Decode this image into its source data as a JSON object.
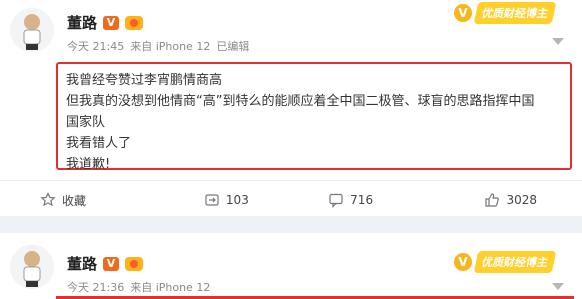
{
  "posts": [
    {
      "author": "董路",
      "verified_badge": "V",
      "timestamp": "今天 21:45",
      "source": "来自 iPhone 12",
      "edited": "已编辑",
      "tag_badge": "优质财经博主",
      "content_lines": [
        "我曾经夸赞过李宵鹏情商高",
        "但我真的没想到他情商“高”到特么的能顺应着全中国二极管、球盲的思路指挥中国",
        "国家队",
        "我看错人了",
        "我道歉!"
      ],
      "actions": {
        "favorite": "收藏",
        "repost_count": "103",
        "comment_count": "716",
        "like_count": "3028"
      }
    },
    {
      "author": "董路",
      "verified_badge": "V",
      "timestamp": "今天 21:36",
      "source": "来自 iPhone 12",
      "tag_badge": "优质财经博主"
    }
  ],
  "colors": {
    "highlight_border": "#e0302f",
    "accent_orange": "#f06a1d",
    "badge_yellow": "#ffcf2b",
    "background": "#eef2f6"
  }
}
